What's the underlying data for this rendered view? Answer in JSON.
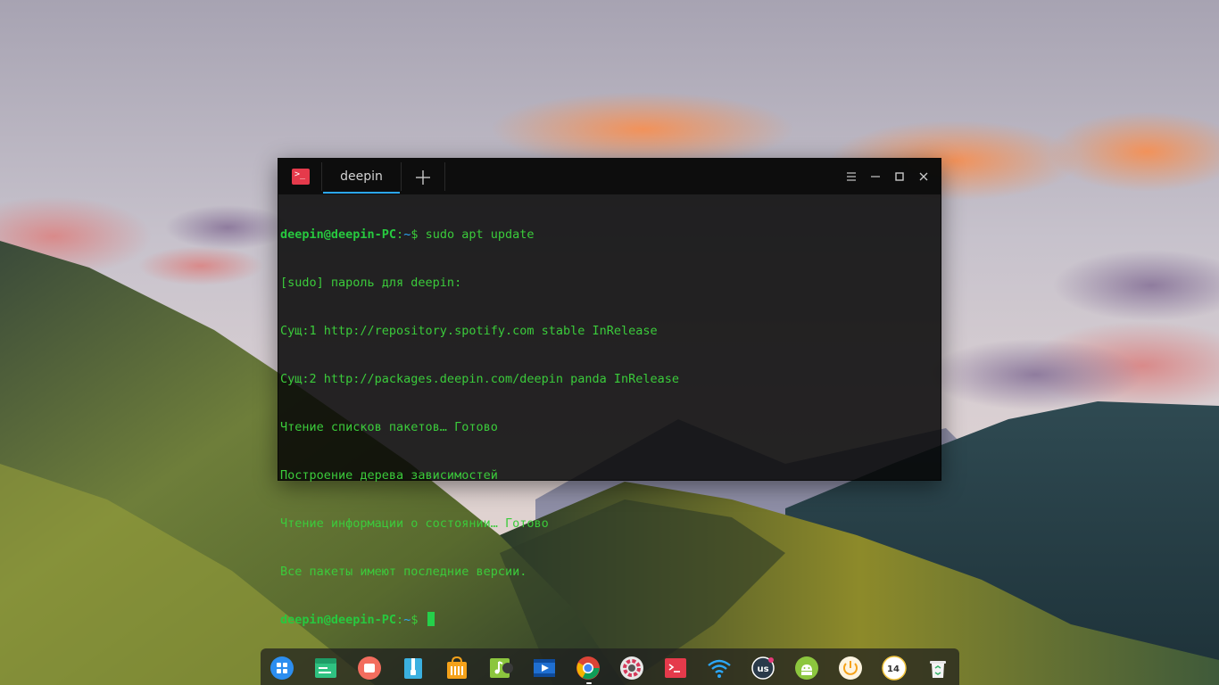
{
  "terminal": {
    "app_icon_glyph": ">_",
    "tab_label": "deepin",
    "new_tab_glyph": "+",
    "prompt_user": "deepin@deepin-PC",
    "prompt_sep": ":",
    "prompt_path": "~",
    "prompt_symbol": "$",
    "command": "sudo apt update",
    "output": [
      "[sudo] пароль для deepin:",
      "Сущ:1 http://repository.spotify.com stable InRelease",
      "Сущ:2 http://packages.deepin.com/deepin panda InRelease",
      "Чтение списков пакетов… Готово",
      "Построение дерева зависимостей",
      "Чтение информации о состоянии… Готово",
      "Все пакеты имеют последние версии."
    ],
    "colors": {
      "prompt_user": "#27c93f",
      "prompt_path": "#2ca7f8",
      "output_text": "#3bcb3b",
      "tab_underline": "#2ca7f8",
      "app_icon_bg": "#e53a4b"
    }
  },
  "dock": {
    "items": [
      {
        "name": "launcher-icon"
      },
      {
        "name": "terminal-green-icon"
      },
      {
        "name": "screen-recorder-icon"
      },
      {
        "name": "archive-manager-icon"
      },
      {
        "name": "app-store-icon"
      },
      {
        "name": "music-player-icon"
      },
      {
        "name": "video-player-icon"
      },
      {
        "name": "chrome-icon"
      },
      {
        "name": "settings-icon"
      },
      {
        "name": "terminal-icon"
      },
      {
        "name": "wifi-icon"
      },
      {
        "name": "keyboard-layout-icon",
        "label": "us"
      },
      {
        "name": "android-icon"
      },
      {
        "name": "power-icon"
      },
      {
        "name": "clock-icon",
        "label": "14"
      },
      {
        "name": "trash-icon"
      }
    ]
  }
}
